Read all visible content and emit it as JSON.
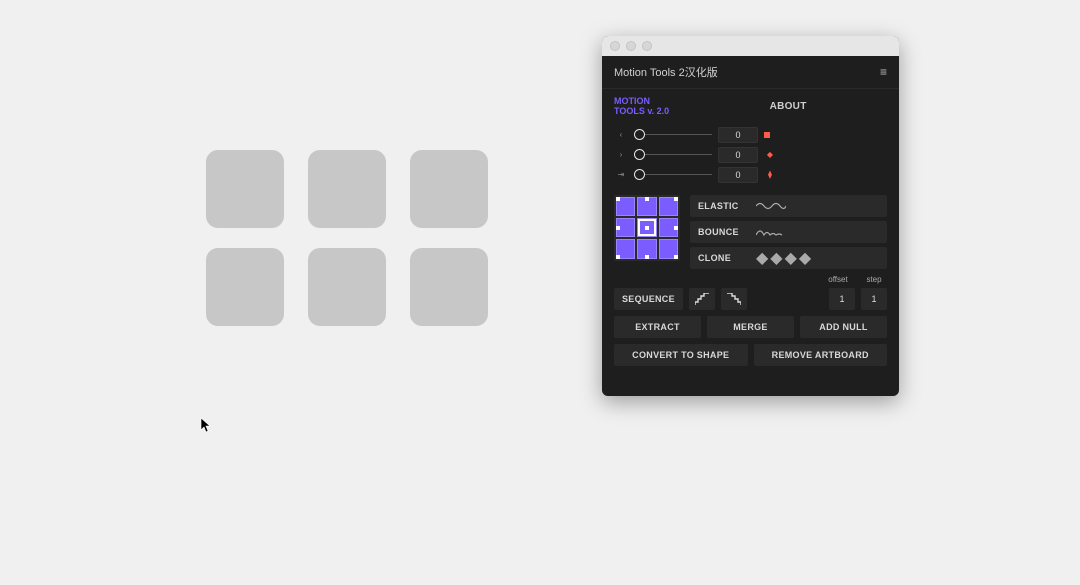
{
  "canvas": {
    "shape_count": 6
  },
  "panel": {
    "title": "Motion Tools 2汉化版",
    "tabs": {
      "brand_line1": "MOTION",
      "brand_line2": "TOOLS v. 2.0",
      "about": "ABOUT"
    },
    "sliders": [
      {
        "icon": "‹",
        "value": "0"
      },
      {
        "icon": "›",
        "value": "0"
      },
      {
        "icon": "⇥",
        "value": "0"
      }
    ],
    "motion_options": {
      "elastic": "ELASTIC",
      "bounce": "BOUNCE",
      "clone": "CLONE"
    },
    "sequence_labels": {
      "offset": "offset",
      "step": "step"
    },
    "sequence": {
      "label": "SEQUENCE",
      "offset": "1",
      "step": "1"
    },
    "buttons": {
      "extract": "EXTRACT",
      "merge": "MERGE",
      "add_null": "ADD NULL",
      "convert_to_shape": "CONVERT TO SHAPE",
      "remove_artboard": "REMOVE ARTBOARD"
    }
  }
}
